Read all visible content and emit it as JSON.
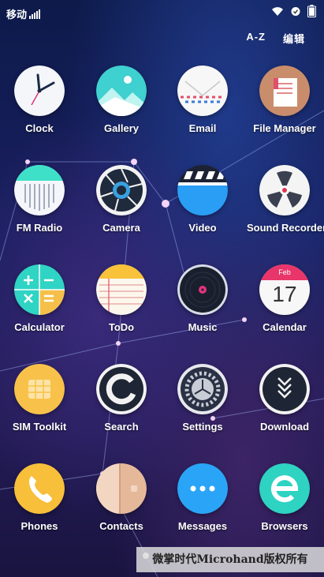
{
  "status_bar": {
    "carrier": "移动",
    "icons": [
      "signal-icon",
      "wifi-icon",
      "alarm-icon",
      "battery-icon"
    ]
  },
  "top_bar": {
    "sort_label": "A-Z",
    "edit_label": "编辑"
  },
  "apps": [
    {
      "label": "Clock",
      "icon": "clock-icon"
    },
    {
      "label": "Gallery",
      "icon": "gallery-icon"
    },
    {
      "label": "Email",
      "icon": "email-icon"
    },
    {
      "label": "File Manager",
      "icon": "file-manager-icon"
    },
    {
      "label": "FM Radio",
      "icon": "fm-radio-icon"
    },
    {
      "label": "Camera",
      "icon": "camera-icon"
    },
    {
      "label": "Video",
      "icon": "video-icon"
    },
    {
      "label": "Sound Recorder",
      "icon": "sound-recorder-icon"
    },
    {
      "label": "Calculator",
      "icon": "calculator-icon"
    },
    {
      "label": "ToDo",
      "icon": "todo-icon"
    },
    {
      "label": "Music",
      "icon": "music-icon"
    },
    {
      "label": "Calendar",
      "icon": "calendar-icon",
      "month": "Feb",
      "day": "17"
    },
    {
      "label": "SIM Toolkit",
      "icon": "sim-toolkit-icon"
    },
    {
      "label": "Search",
      "icon": "search-icon"
    },
    {
      "label": "Settings",
      "icon": "settings-icon"
    },
    {
      "label": "Download",
      "icon": "download-icon"
    },
    {
      "label": "Phones",
      "icon": "phone-icon"
    },
    {
      "label": "Contacts",
      "icon": "contacts-icon"
    },
    {
      "label": "Messages",
      "icon": "messages-icon"
    },
    {
      "label": "Browsers",
      "icon": "browser-icon"
    }
  ],
  "page_indicator": {
    "pages": 2,
    "current": 1
  },
  "watermark": "微掌时代Microhand版权所有"
}
